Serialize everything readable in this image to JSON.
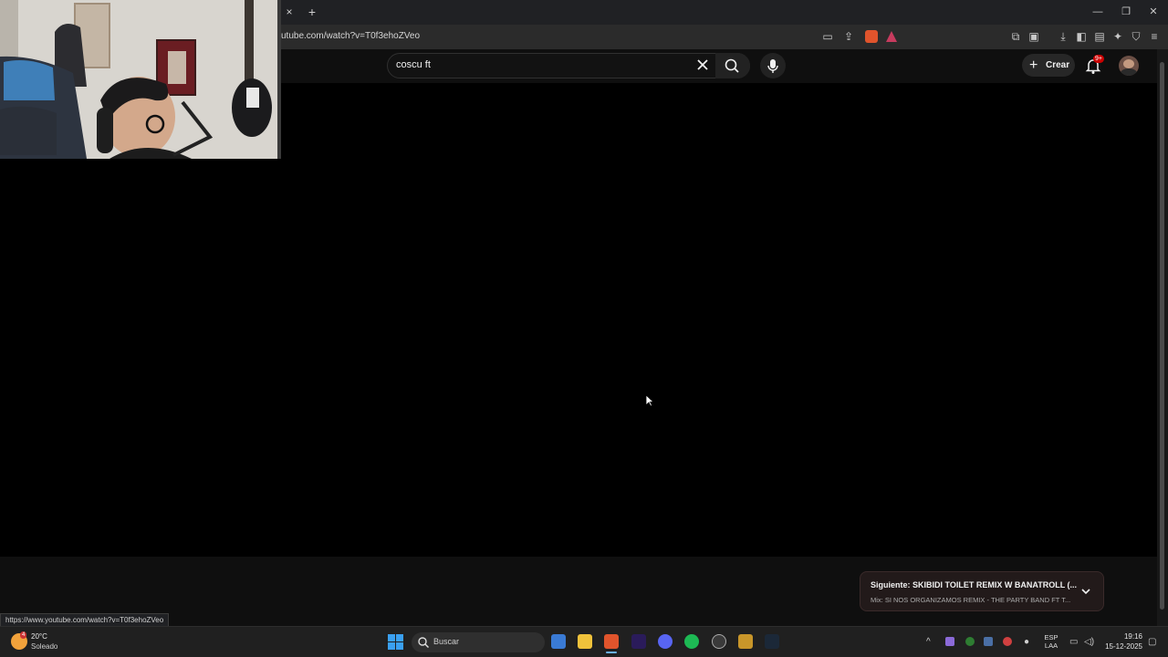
{
  "browser": {
    "url": "utube.com/watch?v=T0f3ehoZVeo",
    "new_tab": "+",
    "close_tab": "×",
    "win_minimize": "—",
    "win_restore": "❐",
    "win_close": "✕"
  },
  "youtube": {
    "search_value": "coscu ft",
    "create_label": "Crear",
    "notification_badge": "9+"
  },
  "up_next": {
    "label": "Siguiente:",
    "title": "SKIBIDI TOILET REMIX W BANATROLL (...",
    "subtitle": "Mix: SI NOS ORGANIZAMOS REMIX - THE PARTY BAND FT T..."
  },
  "status_url": "https://www.youtube.com/watch?v=T0f3ehoZVeo",
  "taskbar": {
    "weather_temp": "20°C",
    "weather_desc": "Soleado",
    "weather_badge": "4",
    "search_placeholder": "Buscar",
    "lang": "ESP",
    "lang_sub": "LAA",
    "time": "19:16",
    "date": "15-12-2025"
  },
  "colors": {
    "accent_red": "#cc0000",
    "player_bg": "#000000"
  }
}
